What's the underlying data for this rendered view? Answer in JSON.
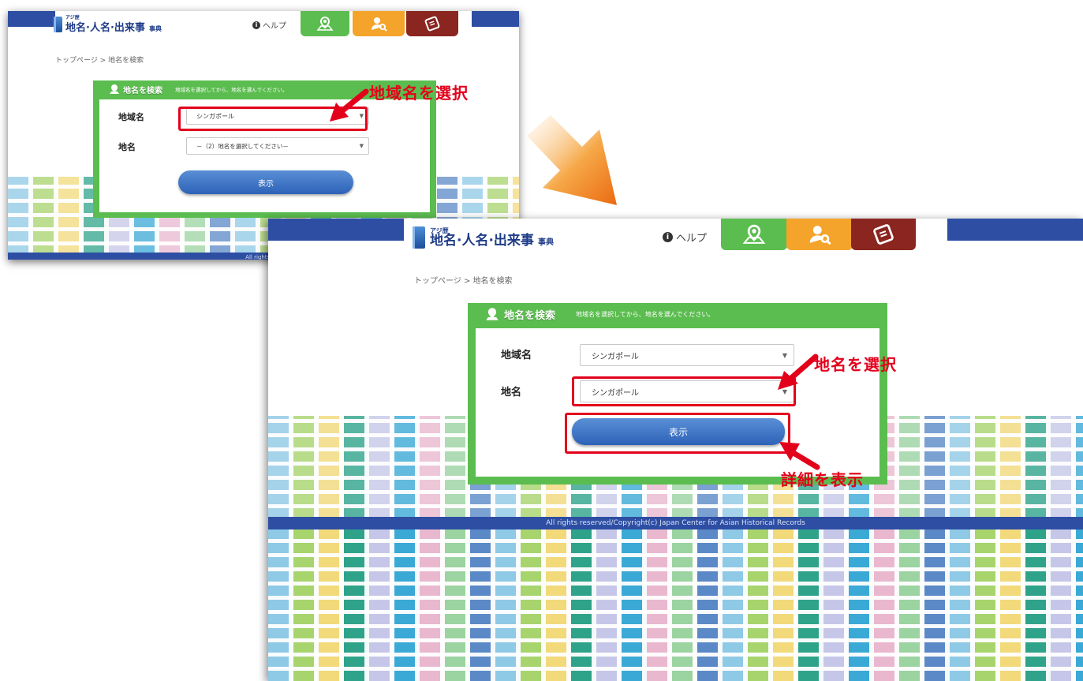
{
  "site": {
    "logo_small": "アジ歴",
    "logo_title": "地名·人名·出来事",
    "logo_suffix": "事典",
    "help_label": "ヘルプ",
    "help_icon": "info-circle-icon",
    "nav_icons": [
      "map-pin-icon",
      "person-search-icon",
      "document-icon"
    ],
    "breadcrumb": "トップページ > 地名を検索",
    "footer": "All rights reserved/Copyright(c) Japan Center for Asian Historical Records"
  },
  "panel": {
    "title": "地名を検索",
    "hint": "地域名を選択してから、地名を選んでください。",
    "region_label": "地域名",
    "place_label": "地名",
    "show_button": "表示"
  },
  "step1": {
    "region_value": "シンガポール",
    "place_value": "－（2）地名を選択してください－"
  },
  "step2": {
    "region_value": "シンガポール",
    "place_value": "シンガポール"
  },
  "annotations": {
    "select_region": "地域名を選択",
    "select_place": "地名を選択",
    "show_details": "詳細を表示"
  },
  "colors": {
    "brand_blue": "#2d4ea3",
    "panel_green": "#5bbd4f",
    "nav_orange": "#f4a42b",
    "nav_maroon": "#8a2520",
    "highlight_red": "#e3001b",
    "arrow_orange": "#f08a1c"
  }
}
